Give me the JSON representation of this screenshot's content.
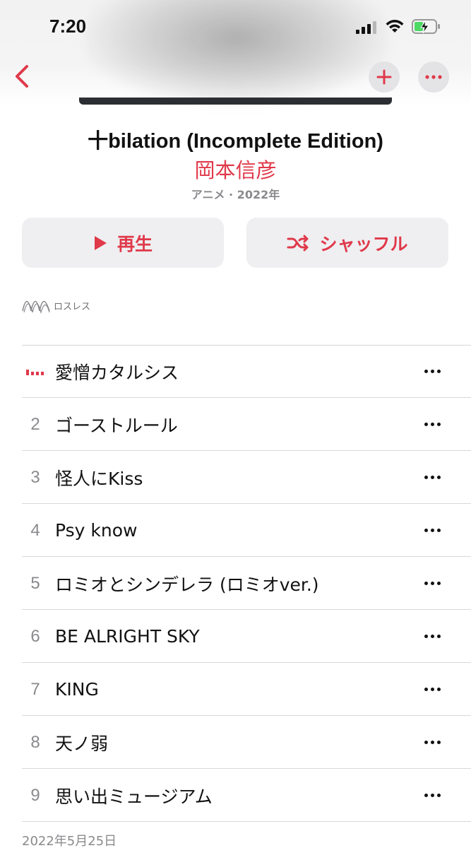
{
  "status_bar": {
    "time": "7:20"
  },
  "colors": {
    "accent": "#e0394a",
    "secondary_text": "#8a8a8e",
    "button_bg": "#efeff1"
  },
  "nav": {
    "back_icon": "chevron-left-icon",
    "add_icon": "plus-icon",
    "more_icon": "ellipsis-icon"
  },
  "album": {
    "title": "十bilation (Incomplete Edition)",
    "artist": "岡本信彦",
    "meta": "アニメ · 2022年"
  },
  "actions": {
    "play_label": "再生",
    "shuffle_label": "シャッフル"
  },
  "badge": {
    "lossless_label": "ロスレス"
  },
  "tracks": [
    {
      "number": "",
      "title": "愛憎カタルシス",
      "now_playing": true
    },
    {
      "number": "2",
      "title": "ゴーストルール"
    },
    {
      "number": "3",
      "title": "怪人にKiss"
    },
    {
      "number": "4",
      "title": "Psy know"
    },
    {
      "number": "5",
      "title": "ロミオとシンデレラ (ロミオver.)"
    },
    {
      "number": "6",
      "title": "BE ALRIGHT SKY"
    },
    {
      "number": "7",
      "title": "KING"
    },
    {
      "number": "8",
      "title": "天ノ弱"
    },
    {
      "number": "9",
      "title": "思い出ミュージアム"
    }
  ],
  "footer": {
    "release_date": "2022年5月25日"
  }
}
